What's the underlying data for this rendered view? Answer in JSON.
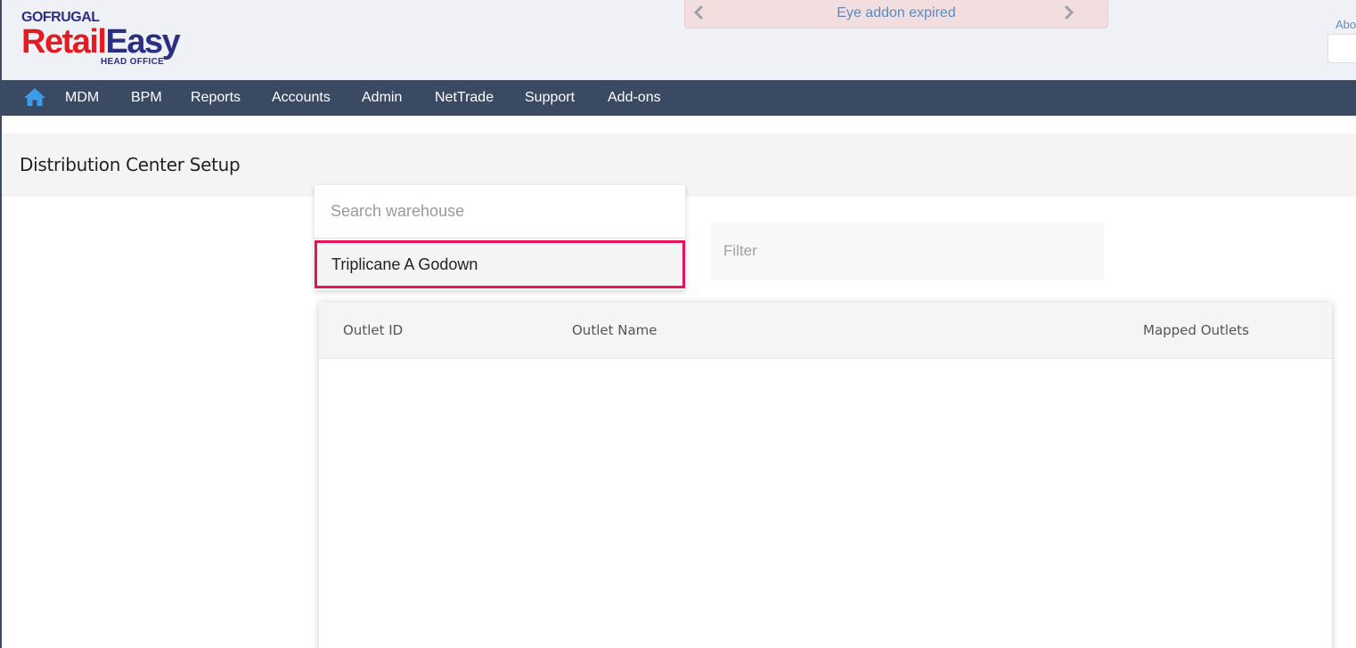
{
  "logo": {
    "brand": "GOFRUGAL",
    "product_part1": "Retail",
    "product_part2": "Easy",
    "edition": "HEAD OFFICE"
  },
  "alert": {
    "message": "Eye addon expired",
    "prev_icon": "chevron-left-icon",
    "next_icon": "chevron-right-icon"
  },
  "header": {
    "about_link": "Abo"
  },
  "nav": {
    "home_icon": "home-icon",
    "items": [
      "MDM",
      "BPM",
      "Reports",
      "Accounts",
      "Admin",
      "NetTrade",
      "Support",
      "Add-ons"
    ]
  },
  "page": {
    "title": "Distribution Center Setup"
  },
  "warehouse_dropdown": {
    "search_placeholder": "Search warehouse",
    "options": [
      "Triplicane A Godown"
    ]
  },
  "filter": {
    "placeholder": "Filter"
  },
  "table": {
    "columns": [
      "Outlet ID",
      "Outlet Name",
      "Mapped Outlets"
    ],
    "rows": []
  },
  "colors": {
    "navbar": "#3b4a63",
    "brand_red": "#e31b23",
    "brand_blue": "#2b2f82",
    "highlight_border": "#e8115a",
    "alert_bg": "#f2dede",
    "alert_text": "#5b8bc1",
    "home_icon": "#3d9be9"
  }
}
